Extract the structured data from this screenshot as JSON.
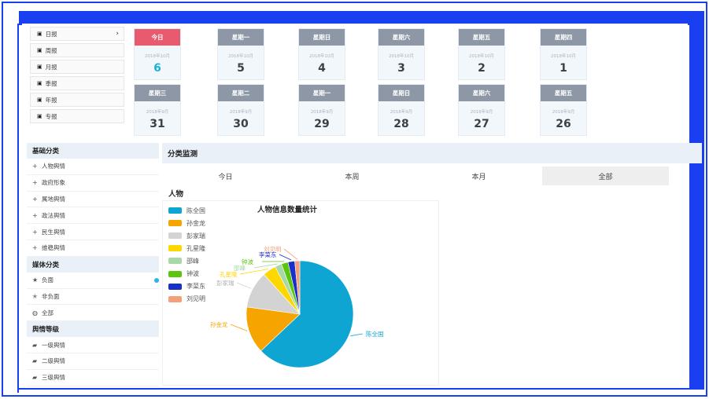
{
  "period_menu": {
    "items": [
      {
        "label": "日报",
        "icon": "calendar-icon",
        "has_chevron": true
      },
      {
        "label": "周报",
        "icon": "calendar-icon"
      },
      {
        "label": "月报",
        "icon": "calendar-icon"
      },
      {
        "label": "季报",
        "icon": "calendar-icon"
      },
      {
        "label": "年报",
        "icon": "calendar-icon"
      },
      {
        "label": "专报",
        "icon": "calendar-icon"
      }
    ],
    "chevron": "›"
  },
  "date_cards": [
    {
      "weekday": "今日",
      "date": "2018年10月",
      "day": "6",
      "today": true
    },
    {
      "weekday": "星期一",
      "date": "2018年10月",
      "day": "5"
    },
    {
      "weekday": "星期日",
      "date": "2018年10月",
      "day": "4"
    },
    {
      "weekday": "星期六",
      "date": "2018年10月",
      "day": "3"
    },
    {
      "weekday": "星期五",
      "date": "2018年10月",
      "day": "2"
    },
    {
      "weekday": "星期四",
      "date": "2018年10月",
      "day": "1"
    },
    {
      "weekday": "星期三",
      "date": "2018年9月",
      "day": "31"
    },
    {
      "weekday": "星期二",
      "date": "2018年9月",
      "day": "30"
    },
    {
      "weekday": "星期一",
      "date": "2018年9月",
      "day": "29"
    },
    {
      "weekday": "星期日",
      "date": "2018年9月",
      "day": "28"
    },
    {
      "weekday": "星期六",
      "date": "2018年9月",
      "day": "27"
    },
    {
      "weekday": "星期五",
      "date": "2018年9月",
      "day": "26"
    }
  ],
  "sidebar": {
    "basic": {
      "title": "基础分类",
      "items": [
        "人物舆情",
        "政府形象",
        "属地舆情",
        "政法舆情",
        "民生舆情",
        "维稳舆情"
      ],
      "icon": "plus-icon",
      "glyph": "+"
    },
    "media": {
      "title": "媒体分类",
      "items": [
        {
          "label": "负面",
          "icon": "star-icon",
          "glyph": "★"
        },
        {
          "label": "非负面",
          "icon": "star-outline-icon",
          "glyph": "✭"
        },
        {
          "label": "全部",
          "icon": "circle-icon",
          "glyph": "◍"
        }
      ]
    },
    "level": {
      "title": "舆情等级",
      "items": [
        "一级舆情",
        "二级舆情",
        "三级舆情"
      ],
      "icon": "flag-icon",
      "glyph": "▰"
    }
  },
  "main": {
    "title": "分类监测",
    "tabs": [
      {
        "label": "今日"
      },
      {
        "label": "本周"
      },
      {
        "label": "本月"
      },
      {
        "label": "全部",
        "active": true
      }
    ],
    "section_title": "人物"
  },
  "chart_data": {
    "type": "pie",
    "title": "人物信息数量统计",
    "legend_position": "left",
    "series": [
      {
        "name": "陈全国",
        "value": 62,
        "color": "#0ea5d3"
      },
      {
        "name": "孙金龙",
        "value": 14,
        "color": "#f5a400"
      },
      {
        "name": "彭家瑞",
        "value": 11,
        "color": "#d3d3d3"
      },
      {
        "name": "孔星隆",
        "value": 4,
        "color": "#ffd700"
      },
      {
        "name": "邵峰",
        "value": 2,
        "color": "#a8d8a8"
      },
      {
        "name": "钟波",
        "value": 2,
        "color": "#5cc60f"
      },
      {
        "name": "李菜东",
        "value": 2,
        "color": "#1a2fc6"
      },
      {
        "name": "刘见明",
        "value": 1.5,
        "color": "#f4a07a"
      }
    ]
  }
}
